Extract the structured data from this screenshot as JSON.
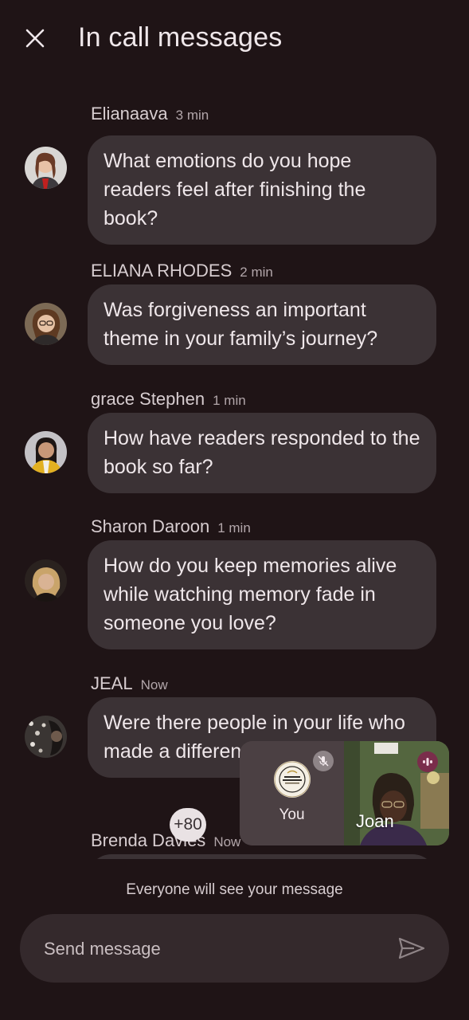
{
  "header": {
    "title": "In call messages",
    "close_icon": "close-icon"
  },
  "messages": [
    {
      "sender": "Elianaava",
      "time": "3 min",
      "text": "What emotions do you hope readers feel after finishing the book?"
    },
    {
      "sender": "ELIANA RHODES",
      "time": "2 min",
      "text": "Was forgiveness an important theme in your family’s journey?"
    },
    {
      "sender": "grace Stephen",
      "time": "1 min",
      "text": "How have readers responded to the book so far?"
    },
    {
      "sender": "Sharon Daroon",
      "time": "1 min",
      "text": "How do you keep memories alive while watching memory fade in someone you love?"
    },
    {
      "sender": "JEAL",
      "time": "Now",
      "text": "Were there people in your life who made a difference during..."
    },
    {
      "sender": "Brenda Davies",
      "time": "Now",
      "text": ""
    }
  ],
  "pip": {
    "you_label": "You",
    "joan_label": "Joan",
    "more_count": "+80",
    "mic_icon": "mic-off-icon",
    "speaking_icon": "speaking-indicator-icon"
  },
  "footer": {
    "visibility_note": "Everyone will see your message",
    "input_placeholder": "Send message",
    "send_icon": "send-icon"
  },
  "colors": {
    "background": "#1f1416",
    "bubble": "#3b3235",
    "composer": "#34292c",
    "speaking_accent": "#7a2d4b"
  }
}
